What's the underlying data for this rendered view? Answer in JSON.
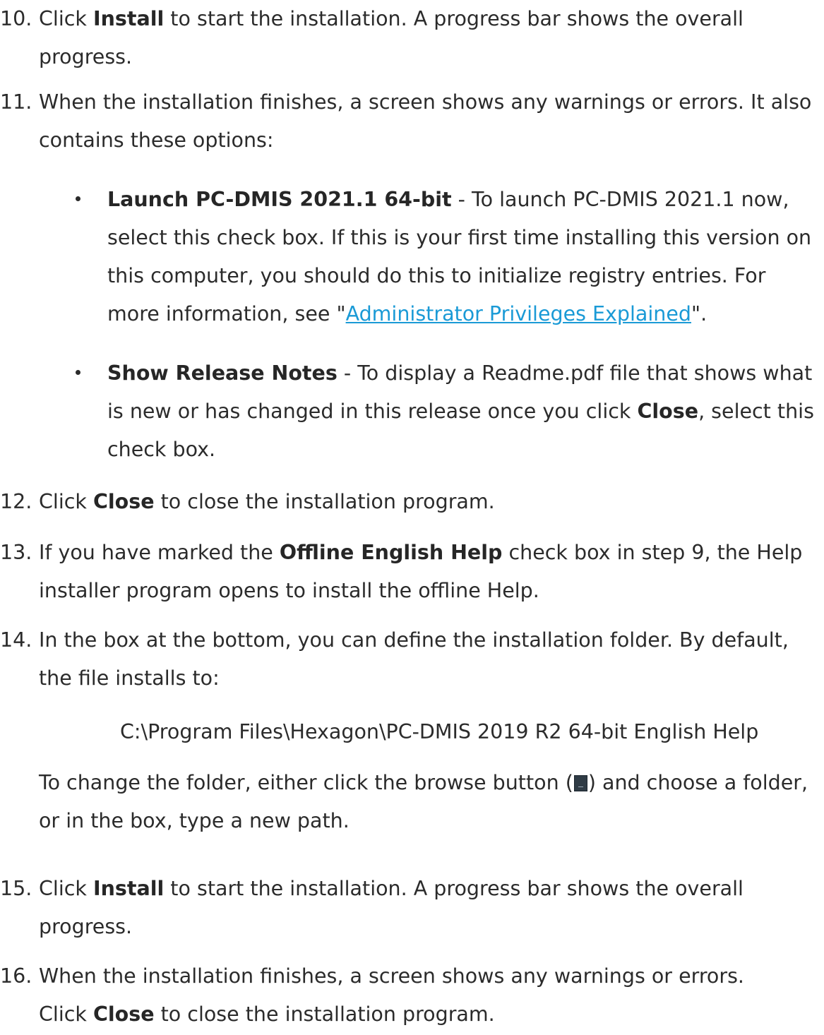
{
  "steps": [
    {
      "num": "10.",
      "pre": "Click ",
      "bold": "Install",
      "post": " to start the installation. A progress bar shows the overall progress."
    },
    {
      "num": "11.",
      "text": "When the installation finishes, a screen shows any warnings or errors. It also contains these options:"
    },
    {
      "num": "12.",
      "pre": "Click ",
      "bold": "Close",
      "post": " to close the installation program."
    },
    {
      "num": "13.",
      "pre": "If you have marked the ",
      "bold": "Offline English Help",
      "post": " check box in step 9, the Help installer program opens to install the offline Help."
    },
    {
      "num": "14.",
      "text": "In the box at the bottom, you can define the installation folder. By default, the file installs to:"
    },
    {
      "num": "15.",
      "pre": "Click ",
      "bold": "Install",
      "post": " to start the installation. A progress bar shows the overall progress."
    },
    {
      "num": "16.",
      "text": "When the installation finishes, a screen shows any warnings or errors.",
      "line2_pre": "Click ",
      "line2_bold": "Close",
      "line2_post": " to close the installation program."
    }
  ],
  "options": [
    {
      "bold": "Launch PC-DMIS 2021.1 64-bit",
      "text": " - To launch PC-DMIS 2021.1 now, select this check box. If this is your first time installing this version on this computer, you should do this to initialize registry entries. For more information, see \"",
      "link": "Administrator Privileges Explained",
      "after": "\"."
    },
    {
      "bold": "Show Release Notes",
      "text": " - To display a Readme.pdf file that shows what is new or has changed in this release once you click ",
      "bold2": "Close",
      "after": ", select this check box."
    }
  ],
  "default_path": "C:\\Program Files\\Hexagon\\PC-DMIS 2019 R2 64-bit English Help",
  "change_folder": {
    "pre": "To change the folder, either click the browse button (",
    "icon": "browse-button-icon",
    "post": ") and choose a folder, or in the box, type a new path."
  }
}
